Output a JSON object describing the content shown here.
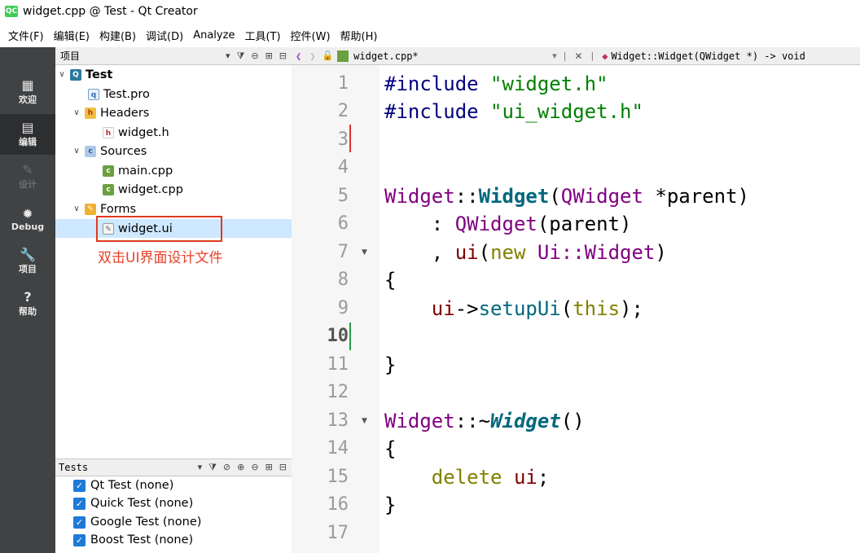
{
  "window": {
    "title": "widget.cpp @ Test - Qt Creator",
    "logo_text": "QC"
  },
  "menu": [
    "文件(F)",
    "编辑(E)",
    "构建(B)",
    "调试(D)",
    "Analyze",
    "工具(T)",
    "控件(W)",
    "帮助(H)"
  ],
  "modes": [
    {
      "label": "欢迎",
      "icon": "▦"
    },
    {
      "label": "编辑",
      "icon": "▤"
    },
    {
      "label": "设计",
      "icon": "✎"
    },
    {
      "label": "Debug",
      "icon": "✹"
    },
    {
      "label": "项目",
      "icon": "🔧"
    },
    {
      "label": "帮助",
      "icon": "?"
    }
  ],
  "projects": {
    "title": "项目",
    "tree": {
      "project": "Test",
      "pro": "Test.pro",
      "headers": "Headers",
      "header_file": "widget.h",
      "sources": "Sources",
      "main_cpp": "main.cpp",
      "widget_cpp": "widget.cpp",
      "forms": "Forms",
      "widget_ui": "widget.ui"
    },
    "annotation": "双击UI界面设计文件"
  },
  "tests": {
    "title": "Tests",
    "items": [
      "Qt Test (none)",
      "Quick Test (none)",
      "Google Test (none)",
      "Boost Test (none)"
    ]
  },
  "editor": {
    "file_tab": "widget.cpp*",
    "symbol": "Widget::Widget(QWidget *) -> void",
    "line_numbers": [
      "1",
      "2",
      "3",
      "4",
      "5",
      "6",
      "7",
      "8",
      "9",
      "10",
      "11",
      "12",
      "13",
      "14",
      "15",
      "16",
      "17"
    ],
    "current_line": "10",
    "code": {
      "l1_directive": "#include",
      "l1_file": "\"widget.h\"",
      "l2_directive": "#include",
      "l2_file": "\"ui_widget.h\"",
      "l5_class": "Widget",
      "l5_sep": "::",
      "l5_ctor": "Widget",
      "l5_open": "(",
      "l5_type": "QWidget",
      "l5_param": " *parent)",
      "l6_colon": "    : ",
      "l6_base": "QWidget",
      "l6_args": "(parent)",
      "l7_comma": "    , ",
      "l7_member": "ui",
      "l7_open": "(",
      "l7_new": "new",
      "l7_space": " ",
      "l7_type": "Ui::Widget",
      "l7_close": ")",
      "l8": "{",
      "l9_indent": "    ",
      "l9_member": "ui",
      "l9_arrow": "->",
      "l9_func": "setupUi",
      "l9_open": "(",
      "l9_this": "this",
      "l9_close": ");",
      "l11": "}",
      "l13_class": "Widget",
      "l13_sep": "::~",
      "l13_dtor": "Widget",
      "l13_parens": "()",
      "l14": "{",
      "l15_indent": "    ",
      "l15_delete": "delete",
      "l15_space": " ",
      "l15_member": "ui",
      "l15_semi": ";",
      "l16": "}"
    }
  }
}
